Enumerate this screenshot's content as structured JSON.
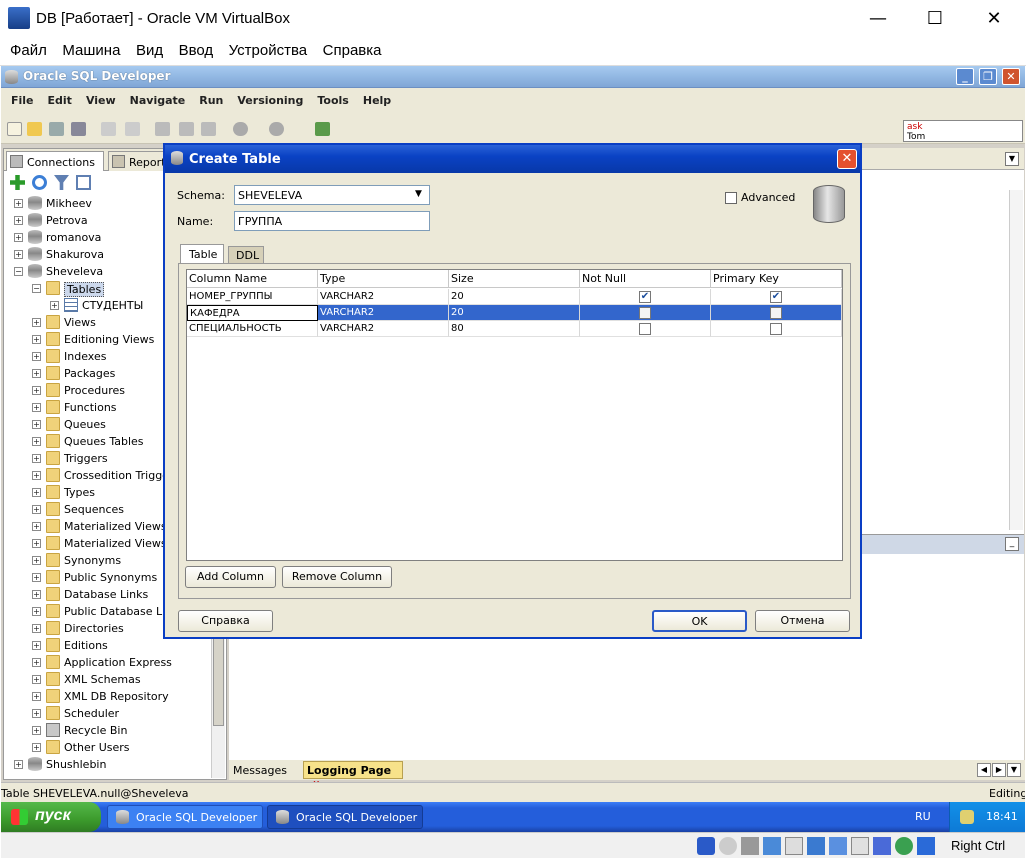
{
  "host": {
    "title": "DB [Работает] - Oracle VM VirtualBox",
    "menu": [
      "Файл",
      "Машина",
      "Вид",
      "Ввод",
      "Устройства",
      "Справка"
    ],
    "controls": {
      "minimize": "—",
      "maximize": "☐",
      "close": "✕"
    }
  },
  "sqldev": {
    "title": "Oracle SQL Developer",
    "menu": [
      "File",
      "Edit",
      "View",
      "Navigate",
      "Run",
      "Versioning",
      "Tools",
      "Help"
    ],
    "ask_box": {
      "line1": "ask",
      "line2": "Tom"
    }
  },
  "left_panel": {
    "tabs": [
      "Connections",
      "Reports"
    ],
    "tab_close": "x",
    "tree": [
      {
        "label": "Mikheev",
        "icon": "database-icon"
      },
      {
        "label": "Petrova",
        "icon": "database-icon"
      },
      {
        "label": "romanova",
        "icon": "database-icon"
      },
      {
        "label": "Shakurova",
        "icon": "database-icon"
      },
      {
        "label": "Sheveleva",
        "icon": "database-icon",
        "expanded": true
      },
      {
        "label": "Tables",
        "icon": "folder-icon",
        "expanded": true,
        "selected": true
      },
      {
        "label": "СТУДЕНТЫ",
        "icon": "table-icon"
      },
      {
        "label": "Views",
        "icon": "folder-icon"
      },
      {
        "label": "Editioning Views",
        "icon": "folder-icon"
      },
      {
        "label": "Indexes",
        "icon": "folder-icon"
      },
      {
        "label": "Packages",
        "icon": "folder-icon"
      },
      {
        "label": "Procedures",
        "icon": "folder-icon"
      },
      {
        "label": "Functions",
        "icon": "folder-icon"
      },
      {
        "label": "Queues",
        "icon": "folder-icon"
      },
      {
        "label": "Queues Tables",
        "icon": "folder-icon"
      },
      {
        "label": "Triggers",
        "icon": "folder-icon"
      },
      {
        "label": "Crossedition Triggers",
        "icon": "folder-icon"
      },
      {
        "label": "Types",
        "icon": "folder-icon"
      },
      {
        "label": "Sequences",
        "icon": "folder-icon"
      },
      {
        "label": "Materialized Views",
        "icon": "folder-icon"
      },
      {
        "label": "Materialized Views Log",
        "icon": "folder-icon"
      },
      {
        "label": "Synonyms",
        "icon": "folder-icon"
      },
      {
        "label": "Public Synonyms",
        "icon": "folder-icon"
      },
      {
        "label": "Database Links",
        "icon": "folder-icon"
      },
      {
        "label": "Public Database Links",
        "icon": "folder-icon"
      },
      {
        "label": "Directories",
        "icon": "folder-icon"
      },
      {
        "label": "Editions",
        "icon": "folder-icon"
      },
      {
        "label": "Application Express",
        "icon": "folder-icon"
      },
      {
        "label": "XML Schemas",
        "icon": "folder-icon"
      },
      {
        "label": "XML DB Repository",
        "icon": "folder-icon"
      },
      {
        "label": "Scheduler",
        "icon": "folder-icon"
      },
      {
        "label": "Recycle Bin",
        "icon": "recycle-bin-icon"
      },
      {
        "label": "Other Users",
        "icon": "folder-icon"
      },
      {
        "label": "Shushlebin",
        "icon": "database-icon"
      }
    ]
  },
  "log_tabs": {
    "messages": "Messages",
    "logging": "Logging Page",
    "close": "x"
  },
  "status": {
    "left": "Table SHEVELEVA.null@Sheveleva",
    "right": "Editing"
  },
  "taskbar": {
    "start": "пуск",
    "tasks": [
      "Oracle SQL Developer",
      "Oracle SQL Developer"
    ],
    "lang": "RU",
    "time": "18:41"
  },
  "vbox_status": {
    "host_key": "Right Ctrl"
  },
  "dialog": {
    "title": "Create Table",
    "close": "✕",
    "schema_label": "Schema:",
    "schema_value": "SHEVELEVA",
    "name_label": "Name:",
    "name_value": "ГРУППА",
    "advanced_label": "Advanced",
    "tabs": [
      "Table",
      "DDL"
    ],
    "columns_header": [
      "Column Name",
      "Type",
      "Size",
      "Not Null",
      "Primary Key"
    ],
    "rows": [
      {
        "name": "НОМЕР_ГРУППЫ",
        "type": "VARCHAR2",
        "size": "20",
        "not_null": true,
        "pk": true
      },
      {
        "name": "КАФЕДРА",
        "type": "VARCHAR2",
        "size": "20",
        "not_null": false,
        "pk": false
      },
      {
        "name": "СПЕЦИАЛЬНОСТЬ",
        "type": "VARCHAR2",
        "size": "80",
        "not_null": false,
        "pk": false
      }
    ],
    "add_column": "Add Column",
    "remove_column": "Remove Column",
    "help": "Справка",
    "ok": "OK",
    "cancel": "Отмена"
  }
}
